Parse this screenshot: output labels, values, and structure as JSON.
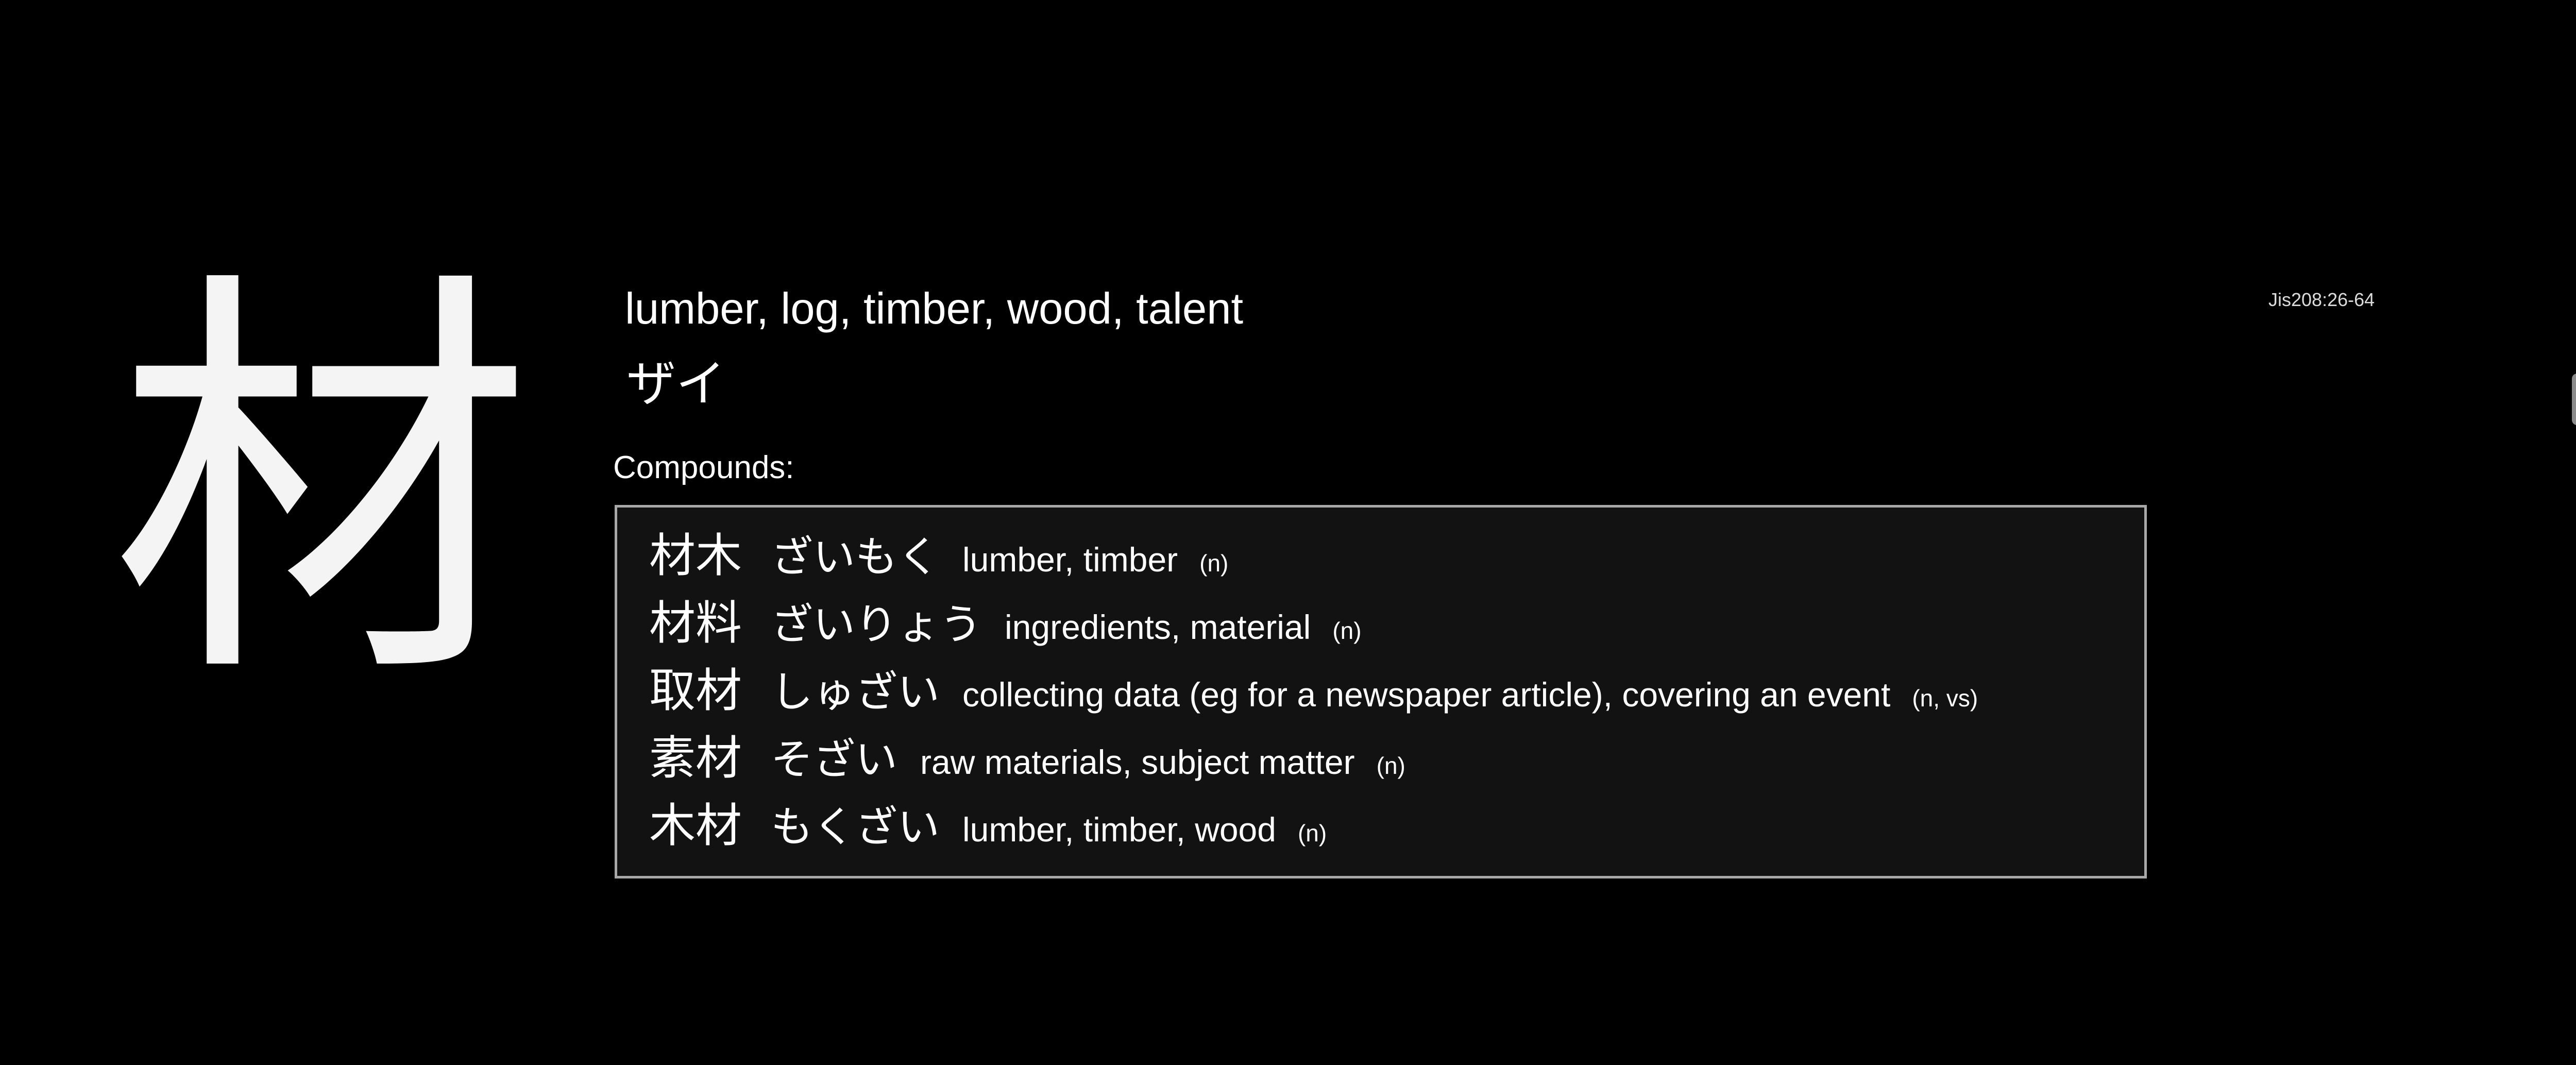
{
  "kanji": {
    "character": "材",
    "meanings": "lumber, log, timber, wood, talent",
    "reading": "ザイ",
    "code": "Jis208:26-64"
  },
  "compounds": {
    "label": "Compounds:",
    "items": [
      {
        "word": "材木",
        "reading": "ざいもく",
        "meaning": "lumber, timber",
        "pos": "(n)"
      },
      {
        "word": "材料",
        "reading": "ざいりょう",
        "meaning": "ingredients, material",
        "pos": "(n)"
      },
      {
        "word": "取材",
        "reading": "しゅざい",
        "meaning": "collecting data (eg for a newspaper article), covering an event",
        "pos": "(n, vs)"
      },
      {
        "word": "素材",
        "reading": "そざい",
        "meaning": "raw materials, subject matter",
        "pos": "(n)"
      },
      {
        "word": "木材",
        "reading": "もくざい",
        "meaning": "lumber, timber, wood",
        "pos": "(n)"
      }
    ]
  },
  "colors": {
    "background": "#000000",
    "text": "#ffffff",
    "box_background": "#121212",
    "box_border": "#a8a8a8"
  }
}
